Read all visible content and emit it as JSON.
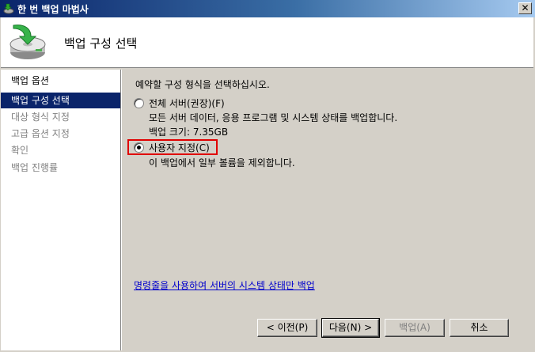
{
  "window": {
    "title": "한 번 백업 마법사",
    "close_glyph": "✕"
  },
  "header": {
    "heading": "백업 구성 선택"
  },
  "nav": {
    "items": [
      {
        "label": "백업 옵션",
        "state": "done"
      },
      {
        "label": "백업 구성 선택",
        "state": "active"
      },
      {
        "label": "대상 형식 지정",
        "state": "future"
      },
      {
        "label": "고급 옵션 지정",
        "state": "future"
      },
      {
        "label": "확인",
        "state": "future"
      },
      {
        "label": "백업 진행률",
        "state": "future"
      }
    ]
  },
  "content": {
    "instruction": "예약할 구성 형식을 선택하십시오.",
    "options": [
      {
        "label": "전체 서버(권장)(F)",
        "checked": false,
        "desc_lines": [
          "모든 서버 데이터, 응용 프로그램 및 시스템 상태를 백업합니다.",
          "백업 크기: 7.35GB"
        ]
      },
      {
        "label": "사용자 지정(C)",
        "checked": true,
        "desc_lines": [
          "이 백업에서 일부 볼륨을 제외합니다."
        ]
      }
    ],
    "link": "명령줄을 사용하여 서버의 시스템 상태만 백업"
  },
  "buttons": {
    "back": "< 이전(P)",
    "next": "다음(N) >",
    "backup": "백업(A)",
    "cancel": "취소"
  },
  "colors": {
    "active_nav": "#0a246a",
    "highlight_border": "#e00000",
    "link": "#0000cc"
  }
}
